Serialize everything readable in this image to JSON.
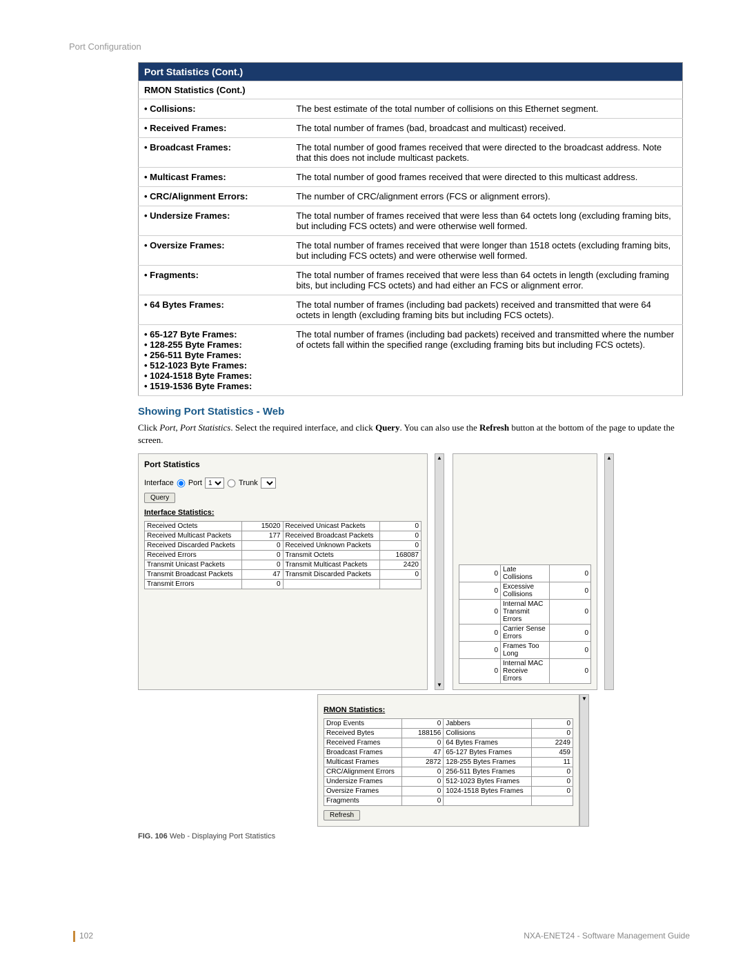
{
  "header": {
    "breadcrumb": "Port Configuration"
  },
  "table": {
    "title": "Port Statistics (Cont.)",
    "section": "RMON Statistics (Cont.)",
    "rows": [
      {
        "label": "• Collisions:",
        "desc": "The best estimate of the total number of collisions on this Ethernet segment."
      },
      {
        "label": "• Received Frames:",
        "desc": "The total number of frames (bad, broadcast and multicast) received."
      },
      {
        "label": "• Broadcast Frames:",
        "desc": "The total number of good frames received that were directed to the broadcast address. Note that this does not include multicast packets."
      },
      {
        "label": "• Multicast Frames:",
        "desc": "The total number of good frames received that were directed to this multicast address."
      },
      {
        "label": "• CRC/Alignment Errors:",
        "desc": "The number of CRC/alignment errors (FCS or alignment errors)."
      },
      {
        "label": "• Undersize Frames:",
        "desc": "The total number of frames received that were less than 64 octets long (excluding framing bits, but including FCS octets) and were otherwise well formed."
      },
      {
        "label": "• Oversize Frames:",
        "desc": "The total number of frames received that were longer than 1518 octets (excluding framing bits, but including FCS octets) and were otherwise well formed."
      },
      {
        "label": "• Fragments:",
        "desc": "The total number of frames received that were less than 64 octets in length (excluding framing bits, but including FCS octets) and had either an FCS or alignment error."
      },
      {
        "label": "• 64 Bytes Frames:",
        "desc": "The total number of frames (including bad packets) received and transmitted that were 64 octets in length (excluding framing bits but including FCS octets)."
      },
      {
        "label": "• 65-127 Byte Frames:\n• 128-255 Byte Frames:\n• 256-511 Byte Frames:\n• 512-1023 Byte Frames:\n• 1024-1518 Byte Frames:\n• 1519-1536 Byte Frames:",
        "desc": "The total number of frames (including bad packets) received and transmitted where the number of octets fall within the specified range (excluding framing bits but including FCS octets)."
      }
    ]
  },
  "subhead": "Showing Port Statistics - Web",
  "para_parts": {
    "p1": "Click ",
    "p2": "Port",
    "p3": ", ",
    "p4": "Port Statistics",
    "p5": ". Select the required interface, and click ",
    "p6": "Query",
    "p7": ". You can also use the ",
    "p8": "Refresh",
    "p9": " button at the bottom of the page to update the screen."
  },
  "screenshot1": {
    "title": "Port Statistics",
    "iface_label": "Interface",
    "port_label": "Port",
    "port_value": "1",
    "trunk_label": "Trunk",
    "query_btn": "Query",
    "section": "Interface Statistics:",
    "rows": [
      [
        "Received Octets",
        "15020",
        "Received Unicast Packets",
        "0"
      ],
      [
        "Received Multicast Packets",
        "177",
        "Received Broadcast Packets",
        "0"
      ],
      [
        "Received Discarded Packets",
        "0",
        "Received Unknown Packets",
        "0"
      ],
      [
        "Received Errors",
        "0",
        "Transmit Octets",
        "168087"
      ],
      [
        "Transmit Unicast Packets",
        "0",
        "Transmit Multicast Packets",
        "2420"
      ],
      [
        "Transmit Broadcast Packets",
        "47",
        "Transmit Discarded Packets",
        "0"
      ],
      [
        "Transmit Errors",
        "0",
        "",
        ""
      ]
    ]
  },
  "screenshot2": {
    "rows": [
      [
        "0",
        "Late Collisions",
        "0"
      ],
      [
        "",
        "0",
        "Excessive Collisions",
        "0"
      ],
      [
        "",
        "0",
        "Internal MAC Transmit Errors",
        "0"
      ],
      [
        "",
        "",
        "0",
        "Carrier Sense Errors",
        "0"
      ],
      [
        "",
        "",
        "0",
        "Frames Too Long",
        "0"
      ],
      [
        "",
        "",
        "0",
        "Internal MAC Receive Errors",
        "0"
      ]
    ],
    "rmon_title": "RMON Statistics:",
    "rmon_rows": [
      [
        "Drop Events",
        "0",
        "Jabbers",
        "0"
      ],
      [
        "Received Bytes",
        "188156",
        "Collisions",
        "0"
      ],
      [
        "Received Frames",
        "0",
        "64 Bytes Frames",
        "2249"
      ],
      [
        "Broadcast Frames",
        "47",
        "65-127 Bytes Frames",
        "459"
      ],
      [
        "Multicast Frames",
        "2872",
        "128-255 Bytes Frames",
        "11"
      ],
      [
        "CRC/Alignment Errors",
        "0",
        "256-511 Bytes Frames",
        "0"
      ],
      [
        "Undersize Frames",
        "0",
        "512-1023 Bytes Frames",
        "0"
      ],
      [
        "Oversize Frames",
        "0",
        "1024-1518 Bytes Frames",
        "0"
      ],
      [
        "Fragments",
        "0",
        "",
        ""
      ]
    ],
    "refresh_btn": "Refresh"
  },
  "caption": {
    "fig": "FIG. 106",
    "text": "  Web - Displaying Port Statistics"
  },
  "footer": {
    "page": "102",
    "doc": "NXA-ENET24 - Software Management Guide"
  }
}
